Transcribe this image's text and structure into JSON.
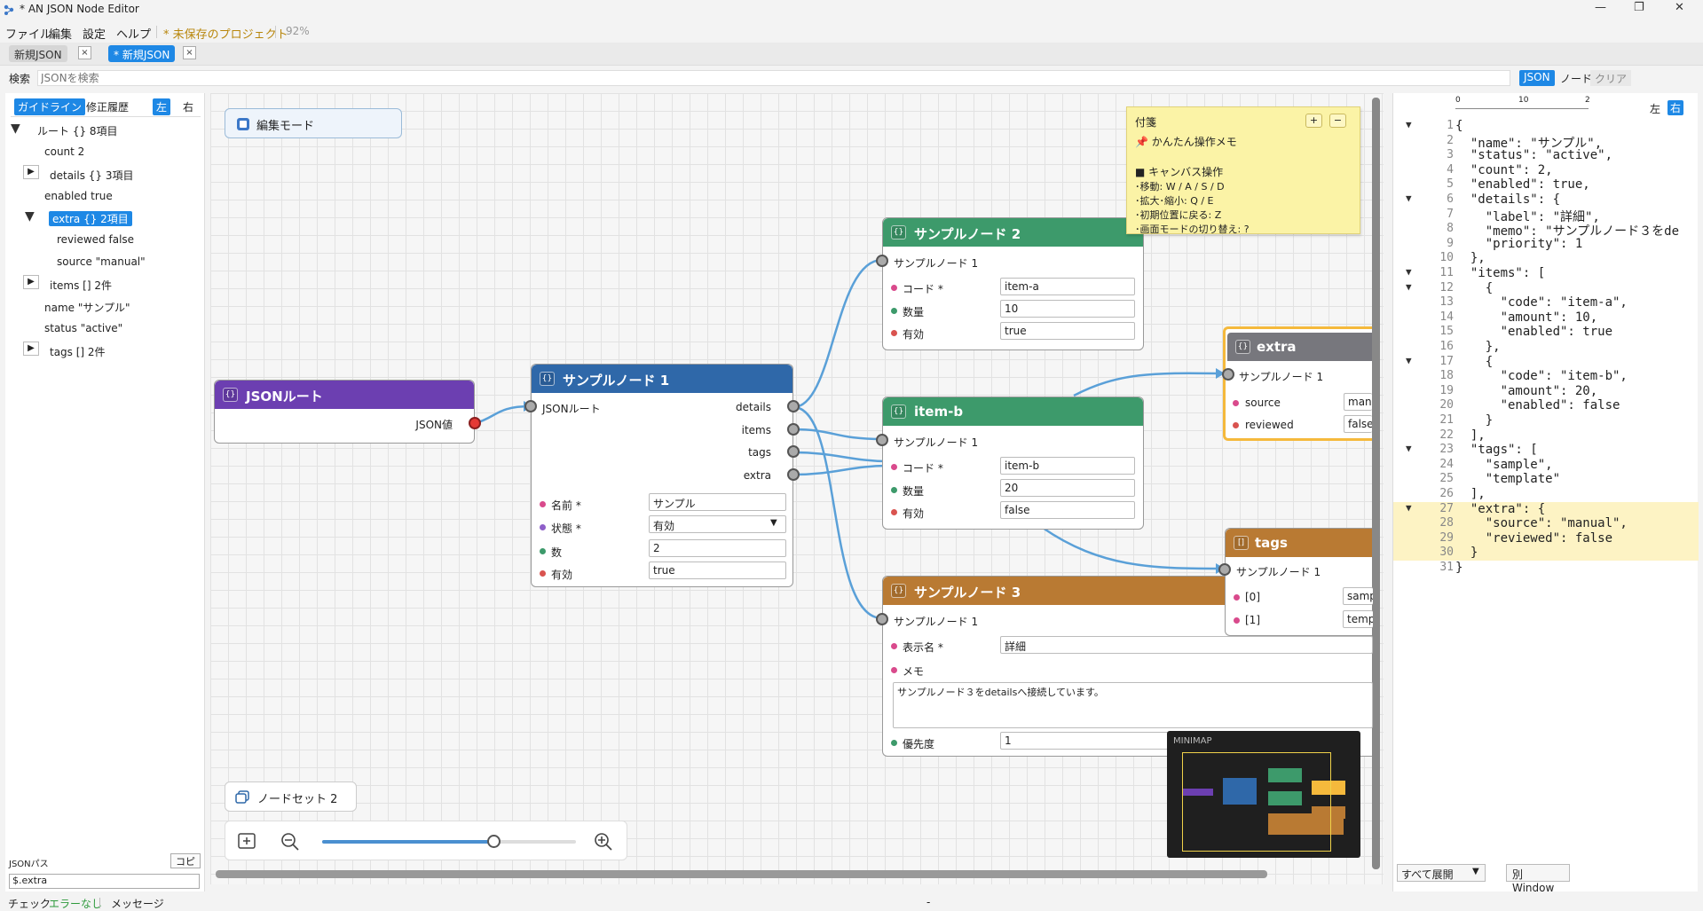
{
  "window": {
    "title": "* AN JSON Node Editor",
    "min": "—",
    "max": "❐",
    "close": "✕"
  },
  "menu": {
    "file": "ファイル",
    "edit": "編集",
    "settings": "設定",
    "help": "ヘルプ",
    "unsaved": "* 未保存のプロジェクト",
    "zoom": "92%"
  },
  "tabs": [
    {
      "label": "新規JSON",
      "close": "×"
    },
    {
      "label": "* 新規JSON",
      "close": "×"
    }
  ],
  "search": {
    "label": "検索",
    "placeholder": "JSONを検索",
    "modes": [
      "JSON",
      "ノード",
      "クリア"
    ]
  },
  "left": {
    "tabs": [
      "ガイドライン",
      "修正履歴"
    ],
    "side": [
      "左",
      "右"
    ],
    "tree": [
      {
        "label": "ルート  {} 8項目",
        "toggle": "▼"
      },
      {
        "label": "count  2"
      },
      {
        "label": "details  {} 3項目",
        "toggle": "▶"
      },
      {
        "label": "enabled  true"
      },
      {
        "label": "extra  {} 2項目",
        "toggle": "▼"
      },
      {
        "label": "reviewed  false"
      },
      {
        "label": "source  \"manual\""
      },
      {
        "label": "items  [] 2件",
        "toggle": "▶"
      },
      {
        "label": "name  \"サンプル\""
      },
      {
        "label": "status  \"active\""
      },
      {
        "label": "tags  [] 2件",
        "toggle": "▶"
      }
    ],
    "jsonpath_label": "JSONパス",
    "copy": "コピー",
    "jsonpath": "$.extra"
  },
  "status": {
    "check": "チェック",
    "errors": "エラーなし",
    "messages": "メッセージ",
    "dash": "-"
  },
  "canvas": {
    "edit_mode": "編集モード",
    "note": {
      "title": "付箋",
      "plus": "+",
      "minus": "−",
      "lines": [
        "📌 かんたん操作メモ",
        "",
        "■ キャンバス操作",
        "･移動: W / A / S / D",
        "･拡大･縮小: Q / E",
        "･初期位置に戻る: Z",
        "･画面モードの切り替え: ?"
      ]
    },
    "node_set": "ノードセット 2",
    "zoom_value": 0.68,
    "minimap_label": "MINIMAP",
    "nodes": {
      "root": {
        "badge": "{}",
        "title": "JSONルート",
        "out": "JSON値"
      },
      "n1": {
        "badge": "{}",
        "title": "サンプルノード 1",
        "in": "JSONルート",
        "outs": [
          "details",
          "items",
          "tags",
          "extra"
        ],
        "fields": [
          {
            "label": "名前 *",
            "value": "サンプル"
          },
          {
            "label": "状態 *",
            "value": "有効"
          },
          {
            "label": "数",
            "value": "2"
          },
          {
            "label": "有効",
            "value": "true"
          }
        ]
      },
      "n2": {
        "badge": "{}",
        "title": "サンプルノード 2",
        "in": "サンプルノード 1",
        "fields": [
          {
            "label": "コード *",
            "value": "item-a"
          },
          {
            "label": "数量",
            "value": "10"
          },
          {
            "label": "有効",
            "value": "true"
          }
        ]
      },
      "itemb": {
        "badge": "{}",
        "title": "item-b",
        "in": "サンプルノード 1",
        "fields": [
          {
            "label": "コード *",
            "value": "item-b"
          },
          {
            "label": "数量",
            "value": "20"
          },
          {
            "label": "有効",
            "value": "false"
          }
        ]
      },
      "n3": {
        "badge": "{}",
        "title": "サンプルノード 3",
        "in": "サンプルノード 1",
        "fields": [
          {
            "label": "表示名 *",
            "value": "詳細"
          },
          {
            "label": "メモ",
            "value": "サンプルノード３をdetailsへ接続しています。"
          },
          {
            "label": "優先度",
            "value": "1"
          }
        ]
      },
      "extra": {
        "badge": "{}",
        "title": "extra",
        "in": "サンプルノード 1",
        "fields": [
          {
            "label": "source",
            "value": "manu"
          },
          {
            "label": "reviewed",
            "value": "false"
          }
        ]
      },
      "tags": {
        "badge": "[]",
        "title": "tags",
        "in": "サンプルノード 1",
        "fields": [
          {
            "label": "[0]",
            "value": "samp"
          },
          {
            "label": "[1]",
            "value": "templ"
          }
        ]
      }
    }
  },
  "right": {
    "ruler": [
      "0",
      "10",
      "2"
    ],
    "side": [
      "左",
      "右"
    ],
    "lines": [
      {
        "n": "1",
        "t": "{",
        "f": "▼"
      },
      {
        "n": "2",
        "t": "  \"name\": \"サンプル\","
      },
      {
        "n": "3",
        "t": "  \"status\": \"active\","
      },
      {
        "n": "4",
        "t": "  \"count\": 2,"
      },
      {
        "n": "5",
        "t": "  \"enabled\": true,"
      },
      {
        "n": "6",
        "t": "  \"details\": {",
        "f": "▼"
      },
      {
        "n": "7",
        "t": "    \"label\": \"詳細\","
      },
      {
        "n": "8",
        "t": "    \"memo\": \"サンプルノード３をde"
      },
      {
        "n": "9",
        "t": "    \"priority\": 1"
      },
      {
        "n": "10",
        "t": "  },"
      },
      {
        "n": "11",
        "t": "  \"items\": [",
        "f": "▼"
      },
      {
        "n": "12",
        "t": "    {",
        "f": "▼"
      },
      {
        "n": "13",
        "t": "      \"code\": \"item-a\","
      },
      {
        "n": "14",
        "t": "      \"amount\": 10,"
      },
      {
        "n": "15",
        "t": "      \"enabled\": true"
      },
      {
        "n": "16",
        "t": "    },"
      },
      {
        "n": "17",
        "t": "    {",
        "f": "▼"
      },
      {
        "n": "18",
        "t": "      \"code\": \"item-b\","
      },
      {
        "n": "19",
        "t": "      \"amount\": 20,"
      },
      {
        "n": "20",
        "t": "      \"enabled\": false"
      },
      {
        "n": "21",
        "t": "    }"
      },
      {
        "n": "22",
        "t": "  ],"
      },
      {
        "n": "23",
        "t": "  \"tags\": [",
        "f": "▼"
      },
      {
        "n": "24",
        "t": "    \"sample\","
      },
      {
        "n": "25",
        "t": "    \"template\""
      },
      {
        "n": "26",
        "t": "  ],"
      },
      {
        "n": "27",
        "t": "  \"extra\": {",
        "f": "▼",
        "hl": true
      },
      {
        "n": "28",
        "t": "    \"source\": \"manual\",",
        "hl": true
      },
      {
        "n": "29",
        "t": "    \"reviewed\": false",
        "hl": true
      },
      {
        "n": "30",
        "t": "  }",
        "hl": true
      },
      {
        "n": "31",
        "t": "}"
      }
    ],
    "expand_all": "すべて展開",
    "other_window": "別Window"
  },
  "colors": {
    "accent": "#1e88e5",
    "root": "#6c3fb1",
    "n1": "#2f68a9",
    "green": "#3d9a6b",
    "orange": "#b97a33",
    "gray": "#77777d",
    "port_red": "#e53935",
    "wire": "#5aa0d8",
    "note": "#fbf3a6",
    "highlight": "#fdf3c4"
  }
}
